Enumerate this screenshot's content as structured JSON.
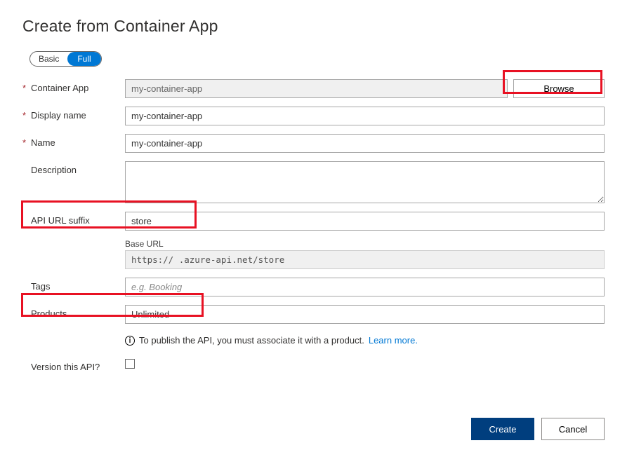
{
  "title": "Create from Container App",
  "toggle": {
    "basic": "Basic",
    "full": "Full"
  },
  "fields": {
    "containerApp": {
      "label": "Container App",
      "value": "my-container-app",
      "browse": "Browse"
    },
    "displayName": {
      "label": "Display name",
      "value": "my-container-app"
    },
    "name": {
      "label": "Name",
      "value": "my-container-app"
    },
    "description": {
      "label": "Description",
      "value": ""
    },
    "apiUrlSuffix": {
      "label": "API URL suffix",
      "value": "store"
    },
    "baseUrl": {
      "label": "Base URL",
      "value": "https://            .azure-api.net/store"
    },
    "tags": {
      "label": "Tags",
      "value": "",
      "placeholder": "e.g. Booking"
    },
    "products": {
      "label": "Products",
      "value": "Unlimited"
    },
    "versionApi": {
      "label": "Version this API?",
      "checked": false
    }
  },
  "info": {
    "text": "To publish the API, you must associate it with a product.",
    "link": "Learn more"
  },
  "footer": {
    "create": "Create",
    "cancel": "Cancel"
  }
}
